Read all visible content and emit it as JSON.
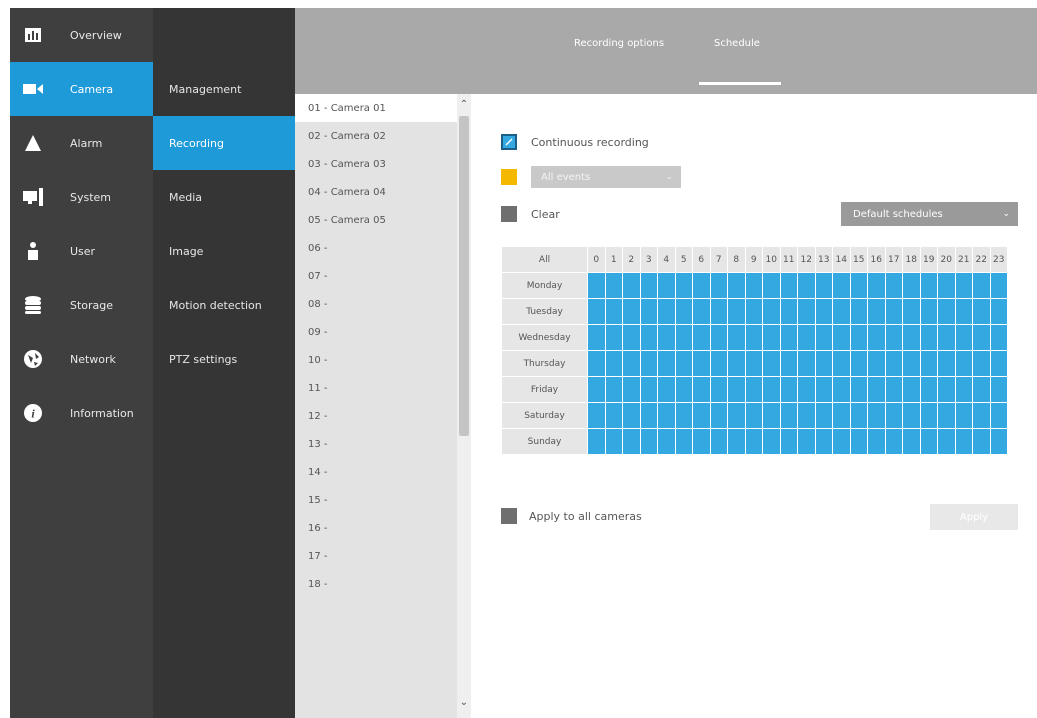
{
  "nav": {
    "items": [
      {
        "label": "Overview",
        "icon": "overview-icon"
      },
      {
        "label": "Camera",
        "icon": "camera-icon",
        "active": true
      },
      {
        "label": "Alarm",
        "icon": "alarm-icon"
      },
      {
        "label": "System",
        "icon": "system-icon"
      },
      {
        "label": "User",
        "icon": "user-icon"
      },
      {
        "label": "Storage",
        "icon": "storage-icon"
      },
      {
        "label": "Network",
        "icon": "network-icon"
      },
      {
        "label": "Information",
        "icon": "information-icon"
      }
    ]
  },
  "subnav": {
    "items": [
      {
        "label": "Management"
      },
      {
        "label": "Recording",
        "active": true
      },
      {
        "label": "Media"
      },
      {
        "label": "Image"
      },
      {
        "label": "Motion detection"
      },
      {
        "label": "PTZ settings"
      }
    ]
  },
  "tabs": {
    "recording_options": "Recording options",
    "schedule": "Schedule"
  },
  "cameras": [
    "01 - Camera 01",
    "02 - Camera 02",
    "03 - Camera 03",
    "04 - Camera 04",
    "05 - Camera 05",
    "06 -",
    "07 -",
    "08 -",
    "09 -",
    "10 -",
    "11 -",
    "12 -",
    "13 -",
    "14 -",
    "15 -",
    "16 -",
    "17 -",
    "18 -"
  ],
  "legend": {
    "continuous": "Continuous recording",
    "events_dropdown": "All events",
    "clear": "Clear"
  },
  "default_schedules": "Default schedules",
  "grid": {
    "all_label": "All",
    "days": [
      "Monday",
      "Tuesday",
      "Wednesday",
      "Thursday",
      "Friday",
      "Saturday",
      "Sunday"
    ],
    "hours": [
      "0",
      "1",
      "2",
      "3",
      "4",
      "5",
      "6",
      "7",
      "8",
      "9",
      "10",
      "11",
      "12",
      "13",
      "14",
      "15",
      "16",
      "17",
      "18",
      "19",
      "20",
      "21",
      "22",
      "23"
    ]
  },
  "apply_all_label": "Apply to all cameras",
  "apply_button": "Apply",
  "colors": {
    "accent": "#1f9ad8",
    "continuous": "#34a8e0",
    "events": "#f5b800",
    "clear": "#6f6f6f"
  }
}
